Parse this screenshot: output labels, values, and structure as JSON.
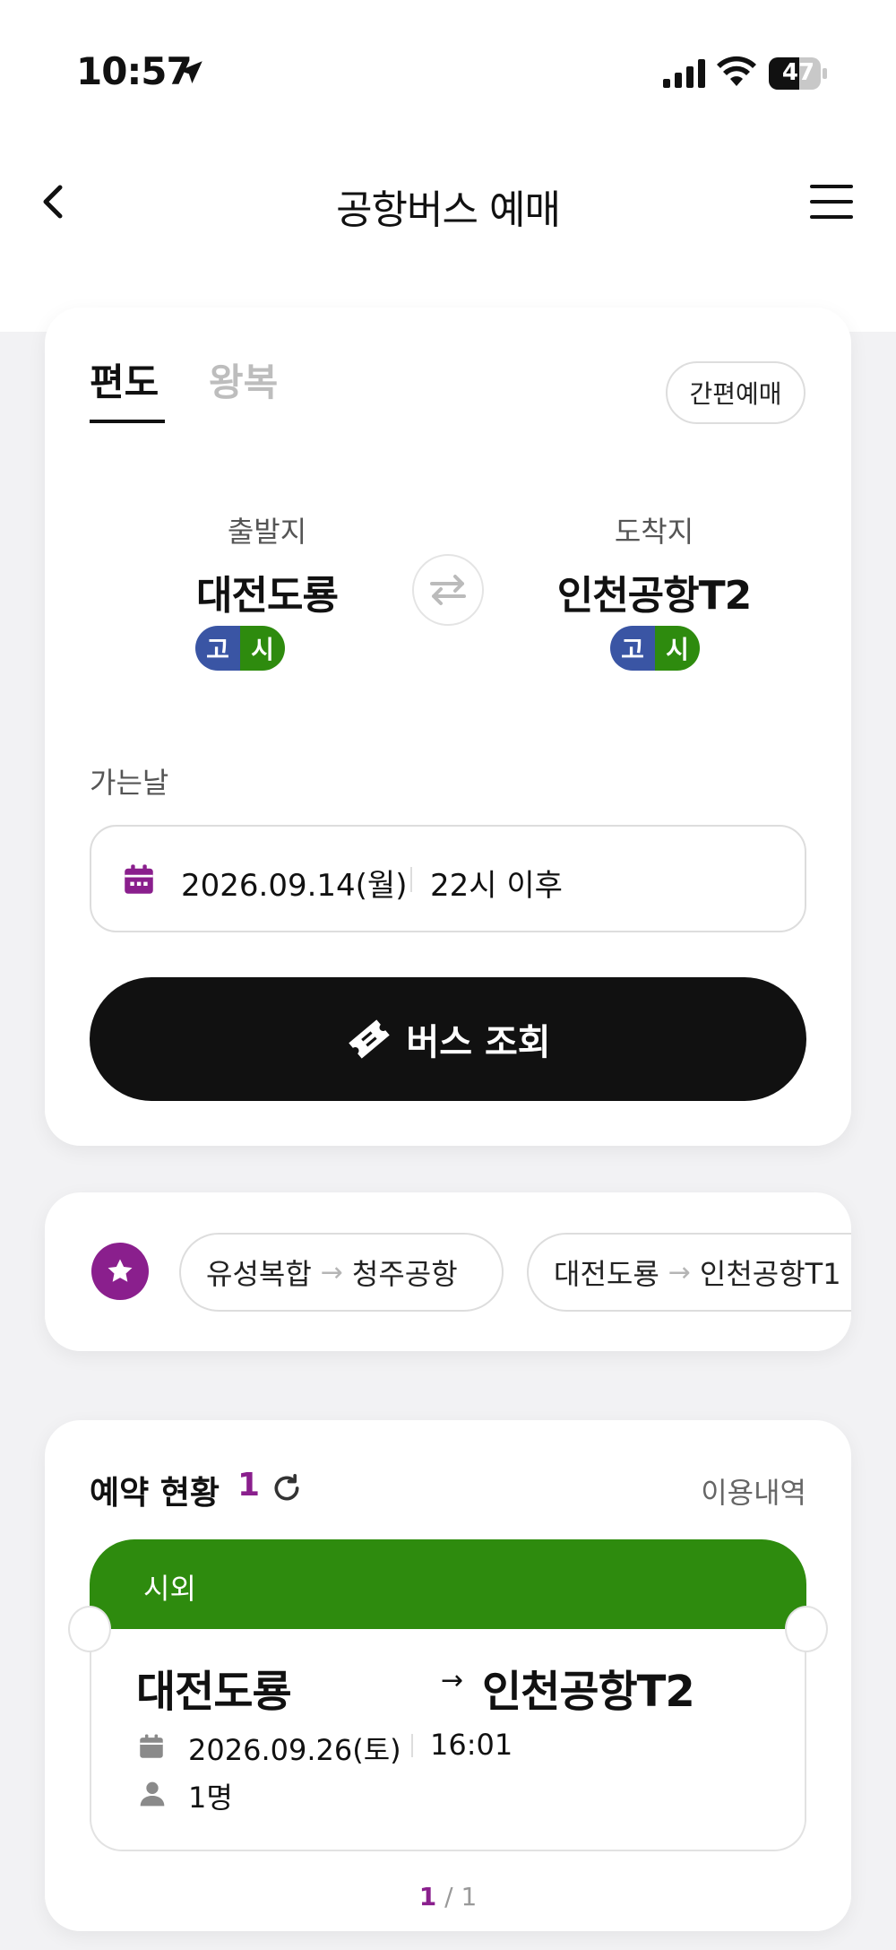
{
  "status_bar": {
    "time": "10:57",
    "battery": "47"
  },
  "header": {
    "title": "공항버스 예매"
  },
  "booking": {
    "tabs": [
      "편도",
      "왕복"
    ],
    "quick_label": "간편예매",
    "origin": {
      "label": "출발지",
      "name": "대전도룡",
      "badges": [
        "고",
        "시"
      ]
    },
    "destination": {
      "label": "도착지",
      "name": "인천공항T2",
      "badges": [
        "고",
        "시"
      ]
    },
    "date_label": "가는날",
    "date_value": "2026.09.14(월)",
    "time_value": "22시 이후",
    "search_label": "버스 조회"
  },
  "favorites": {
    "routes": [
      {
        "from": "유성복합",
        "to": "청주공항"
      },
      {
        "from": "대전도룡",
        "to": "인천공항T1"
      }
    ]
  },
  "reservations": {
    "title": "예약 현황",
    "count": "1",
    "history_label": "이용내역",
    "ticket": {
      "type": "시외",
      "from": "대전도룡",
      "arrow": "→",
      "to": "인천공항T2",
      "date": "2026.09.26(토)",
      "time": "16:01",
      "passengers": "1명"
    },
    "pager": {
      "current": "1",
      "total": "/ 1"
    }
  },
  "colors": {
    "accent": "#8a1f8d",
    "green": "#2e8b0e",
    "blue": "#3a55a4",
    "dark": "#111111"
  },
  "icons": [
    "location-arrow-icon",
    "signal-icon",
    "wifi-icon",
    "battery-icon",
    "back-icon",
    "menu-icon",
    "swap-icon",
    "calendar-icon",
    "ticket-icon",
    "star-icon",
    "refresh-icon",
    "person-icon"
  ]
}
